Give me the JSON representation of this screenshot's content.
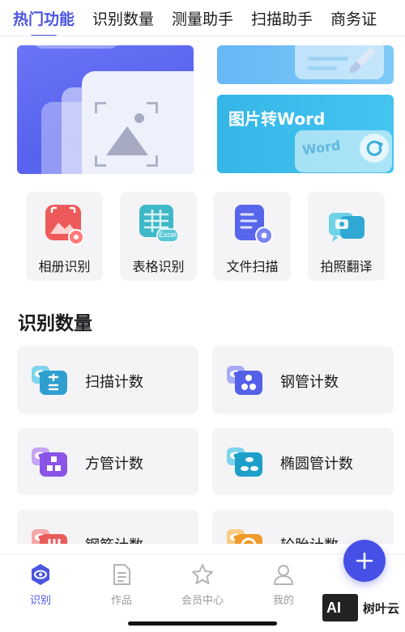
{
  "tabs": [
    {
      "label": "热门功能",
      "active": true
    },
    {
      "label": "识别数量",
      "active": false
    },
    {
      "label": "测量助手",
      "active": false
    },
    {
      "label": "扫描助手",
      "active": false
    },
    {
      "label": "商务证",
      "active": false
    }
  ],
  "banners": {
    "image_to_word_title": "图片转Word",
    "word_badge": "Word"
  },
  "tools": [
    {
      "label": "相册识别",
      "icon": "album-recognize-icon"
    },
    {
      "label": "表格识别",
      "icon": "table-recognize-icon",
      "badge": "Excel"
    },
    {
      "label": "文件扫描",
      "icon": "file-scan-icon"
    },
    {
      "label": "拍照翻译",
      "icon": "photo-translate-icon"
    }
  ],
  "section": {
    "title": "识别数量",
    "cards": [
      {
        "label": "扫描计数"
      },
      {
        "label": "钢管计数"
      },
      {
        "label": "方管计数"
      },
      {
        "label": "椭圆管计数"
      },
      {
        "label": "钢筋计数"
      },
      {
        "label": "轮胎计数"
      }
    ]
  },
  "bottom_nav": [
    {
      "label": "识别",
      "active": true
    },
    {
      "label": "作品",
      "active": false
    },
    {
      "label": "会员中心",
      "active": false
    },
    {
      "label": "我的",
      "active": false
    }
  ],
  "watermark": {
    "logo": "AI",
    "text": "树叶云"
  },
  "colors": {
    "accent": "#4b55e0",
    "fab": "#4750e6",
    "card_bg": "#f4f4f6",
    "banner_blue": "#5763ee",
    "banner_cyan": "#35b6e8"
  }
}
